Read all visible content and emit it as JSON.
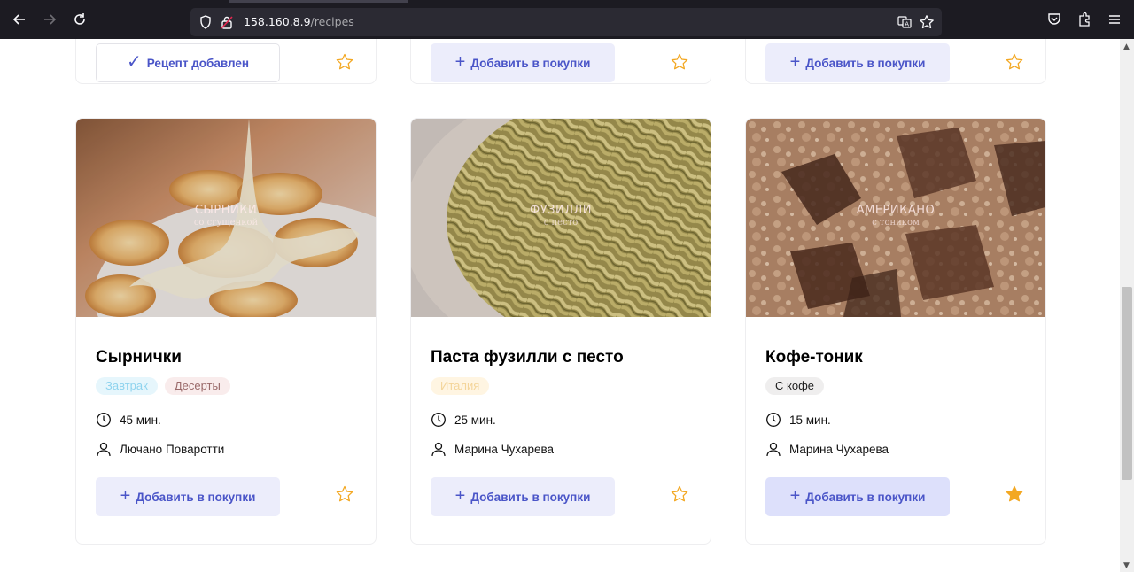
{
  "browser": {
    "url_host": "158.160.8.9",
    "url_path": "/recipes"
  },
  "top_cards": [
    {
      "button_label": "Рецепт добавлен"
    },
    {
      "button_label": "Добавить в покупки"
    },
    {
      "button_label": "Добавить в покупки"
    }
  ],
  "recipes": [
    {
      "image_title": "СЫРНИКИ",
      "image_subtitle": "со сгущенкой",
      "title": "Сырнички",
      "tags": [
        {
          "label": "Завтрак",
          "color": "#8ed3ee"
        },
        {
          "label": "Десерты",
          "color": "#9a6a6a"
        }
      ],
      "time": "45 мин.",
      "author": "Лючано Поваротти",
      "button_label": "Добавить в покупки",
      "favorite": false
    },
    {
      "image_title": "ФУЗИЛЛИ",
      "image_subtitle": "с песто",
      "title": "Паста фузилли с песто",
      "tags": [
        {
          "label": "Италия",
          "color": "#f4d59a"
        }
      ],
      "time": "25 мин.",
      "author": "Марина Чухарева",
      "button_label": "Добавить в покупки",
      "favorite": false
    },
    {
      "image_title": "АМЕРИКАНО",
      "image_subtitle": "с тоником",
      "title": "Кофе-тоник",
      "tags": [
        {
          "label": "С кофе",
          "color": "#222222"
        }
      ],
      "time": "15 мин.",
      "author": "Марина Чухарева",
      "button_label": "Добавить в покупки",
      "favorite": true
    }
  ],
  "icons": {
    "back": "arrow-left-icon",
    "forward": "arrow-right-icon",
    "reload": "reload-icon",
    "shield": "shield-icon",
    "lock": "lock-icon",
    "translate": "translate-icon",
    "bookmark": "star-bookmark-icon",
    "pocket": "pocket-icon",
    "extensions": "extensions-icon",
    "menu": "hamburger-menu-icon",
    "time": "clock-icon",
    "author": "user-icon",
    "favorite": "star-icon"
  },
  "colors": {
    "accent": "#4a55c8",
    "button_bg": "#ecedfb",
    "star": "#f3a823"
  }
}
